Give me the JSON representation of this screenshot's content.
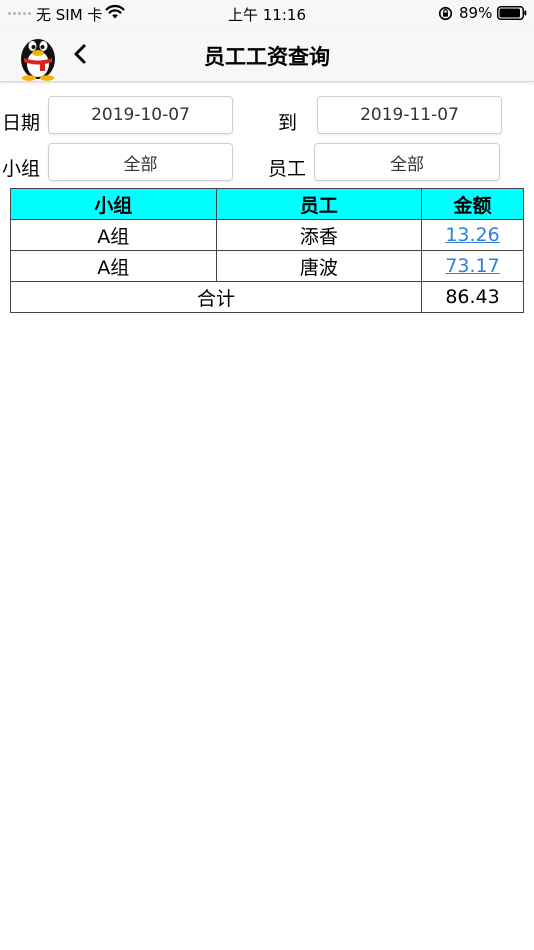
{
  "status_bar": {
    "carrier": "无 SIM 卡",
    "time": "上午 11:16",
    "battery": "89%"
  },
  "nav": {
    "title": "员工工资查询",
    "back_icon": "chevron-left-icon",
    "avatar_icon": "qq-penguin-icon"
  },
  "filters": {
    "date_label": "日期",
    "date_from": "2019-10-07",
    "to_label": "到",
    "date_to": "2019-11-07",
    "group_label": "小组",
    "group_value": "全部",
    "employee_label": "员工",
    "employee_value": "全部"
  },
  "table": {
    "headers": [
      "小组",
      "员工",
      "金额"
    ],
    "rows": [
      {
        "group": "A组",
        "employee": "添香",
        "amount": "13.26"
      },
      {
        "group": "A组",
        "employee": "唐波",
        "amount": "73.17"
      }
    ],
    "total_label": "合计",
    "total_amount": "86.43",
    "header_color": "#00ffff",
    "link_color": "#2f7fe0"
  }
}
